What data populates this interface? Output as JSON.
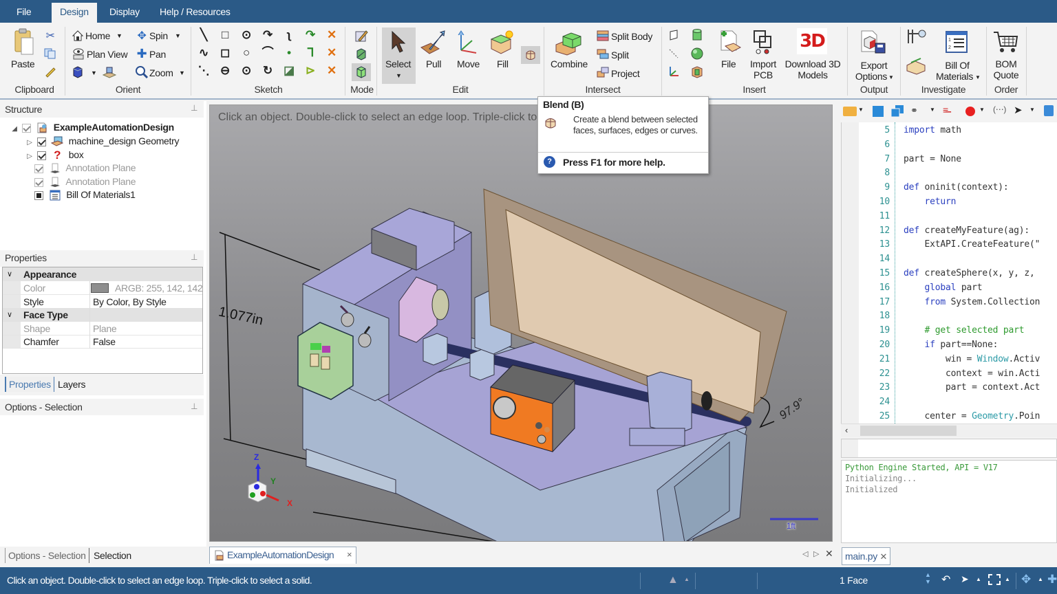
{
  "menu": {
    "tabs": [
      {
        "label": "File",
        "active": false
      },
      {
        "label": "Design",
        "active": true
      },
      {
        "label": "Display",
        "active": false
      },
      {
        "label": "Help / Resources",
        "active": false
      }
    ]
  },
  "ribbon": {
    "clipboard": {
      "label": "Clipboard",
      "paste": "Paste"
    },
    "orient": {
      "label": "Orient",
      "home": "Home",
      "spin": "Spin",
      "plan_view": "Plan View",
      "pan": "Pan",
      "zoom": "Zoom"
    },
    "sketch": {
      "label": "Sketch"
    },
    "mode": {
      "label": "Mode"
    },
    "edit": {
      "label": "Edit",
      "select": "Select",
      "pull": "Pull",
      "move": "Move",
      "fill": "Fill"
    },
    "intersect": {
      "label": "Intersect",
      "combine": "Combine",
      "split_body": "Split Body",
      "split": "Split",
      "project": "Project"
    },
    "insert": {
      "label": "Insert",
      "file": "File",
      "import_pcb_1": "Import",
      "import_pcb_2": "PCB",
      "download_1": "Download 3D",
      "download_2": "Models",
      "download_badge": "3D"
    },
    "output": {
      "label": "Output",
      "export_1": "Export",
      "export_2": "Options"
    },
    "investigate": {
      "label": "Investigate",
      "bom_1": "Bill Of",
      "bom_2": "Materials"
    },
    "order": {
      "label": "Order",
      "quote_1": "BOM",
      "quote_2": "Quote"
    }
  },
  "structure": {
    "title": "Structure",
    "items": [
      {
        "label": "ExampleAutomationDesign",
        "bold": true
      },
      {
        "label": "machine_design Geometry"
      },
      {
        "label": "box"
      },
      {
        "label": "Annotation Plane",
        "dim": true
      },
      {
        "label": "Annotation Plane",
        "dim": true
      },
      {
        "label": "Bill Of Materials1"
      }
    ]
  },
  "properties": {
    "title": "Properties",
    "sections": [
      {
        "name": "Appearance",
        "rows": [
          {
            "key": "Color",
            "value": "ARGB: 255, 142, 142",
            "dim": true,
            "swatch": "#8e8e8e"
          },
          {
            "key": "Style",
            "value": "By Color, By Style"
          }
        ]
      },
      {
        "name": "Face Type",
        "rows": [
          {
            "key": "Shape",
            "value": "Plane",
            "dim": true
          },
          {
            "key": "Chamfer",
            "value": "False"
          }
        ]
      }
    ],
    "tabs": [
      "Properties",
      "Layers"
    ]
  },
  "options": {
    "title": "Options - Selection",
    "tabs": [
      "Options - Selection",
      "Selection"
    ]
  },
  "viewport": {
    "hint": "Click an object. Double-click to select an edge loop. Triple-click to select a solid.",
    "dimension_height": "1.077in",
    "dimension_angle": "97.9°",
    "scale_bar": "1ft",
    "axes": {
      "x": "X",
      "y": "Y",
      "z": "Z"
    },
    "doc_tab": "ExampleAutomationDesign"
  },
  "tooltip": {
    "title": "Blend (B)",
    "description": "Create a blend between selected faces, surfaces, edges or curves.",
    "help": "Press F1 for more help."
  },
  "script_editor": {
    "lines": [
      {
        "n": "5",
        "html": "<span class=\"kw\">import</span> math"
      },
      {
        "n": "6",
        "html": ""
      },
      {
        "n": "7",
        "html": "part = None"
      },
      {
        "n": "8",
        "html": ""
      },
      {
        "n": "9",
        "html": "<span class=\"kw\">def</span> oninit(context):"
      },
      {
        "n": "10",
        "html": "    <span class=\"kw\">return</span>"
      },
      {
        "n": "11",
        "html": ""
      },
      {
        "n": "12",
        "html": "<span class=\"kw\">def</span> createMyFeature(ag):"
      },
      {
        "n": "13",
        "html": "    ExtAPI.CreateFeature(\""
      },
      {
        "n": "14",
        "html": ""
      },
      {
        "n": "15",
        "html": "<span class=\"kw\">def</span> createSphere(x, y, z,"
      },
      {
        "n": "16",
        "html": "    <span class=\"kw\">global</span> part"
      },
      {
        "n": "17",
        "html": "    <span class=\"kw\">from</span> System.Collection"
      },
      {
        "n": "18",
        "html": ""
      },
      {
        "n": "19",
        "html": "    <span class=\"cm\"># get selected part</span>"
      },
      {
        "n": "20",
        "html": "    <span class=\"kw\">if</span> part==None:"
      },
      {
        "n": "21",
        "html": "        win = <span class=\"cls\">Window</span>.Activ"
      },
      {
        "n": "22",
        "html": "        context = win.Acti"
      },
      {
        "n": "23",
        "html": "        part = context.Act"
      },
      {
        "n": "24",
        "html": ""
      },
      {
        "n": "25",
        "html": "    center = <span class=\"cls\">Geometry</span>.Poin"
      }
    ],
    "console": [
      "Python Engine Started, API = V17",
      "Initializing...",
      "Initialized"
    ],
    "file_tab": "main.py"
  },
  "status": {
    "message": "Click an object. Double-click to select an edge loop. Triple-click to select a solid.",
    "selection_count": "1 Face"
  },
  "colors": {
    "accent": "#2b5a87",
    "viewport_bg": "#8e8e91",
    "machine_body": "#a7a6d8",
    "orange_block": "#f07a22",
    "lid": "#d9c3a8"
  }
}
